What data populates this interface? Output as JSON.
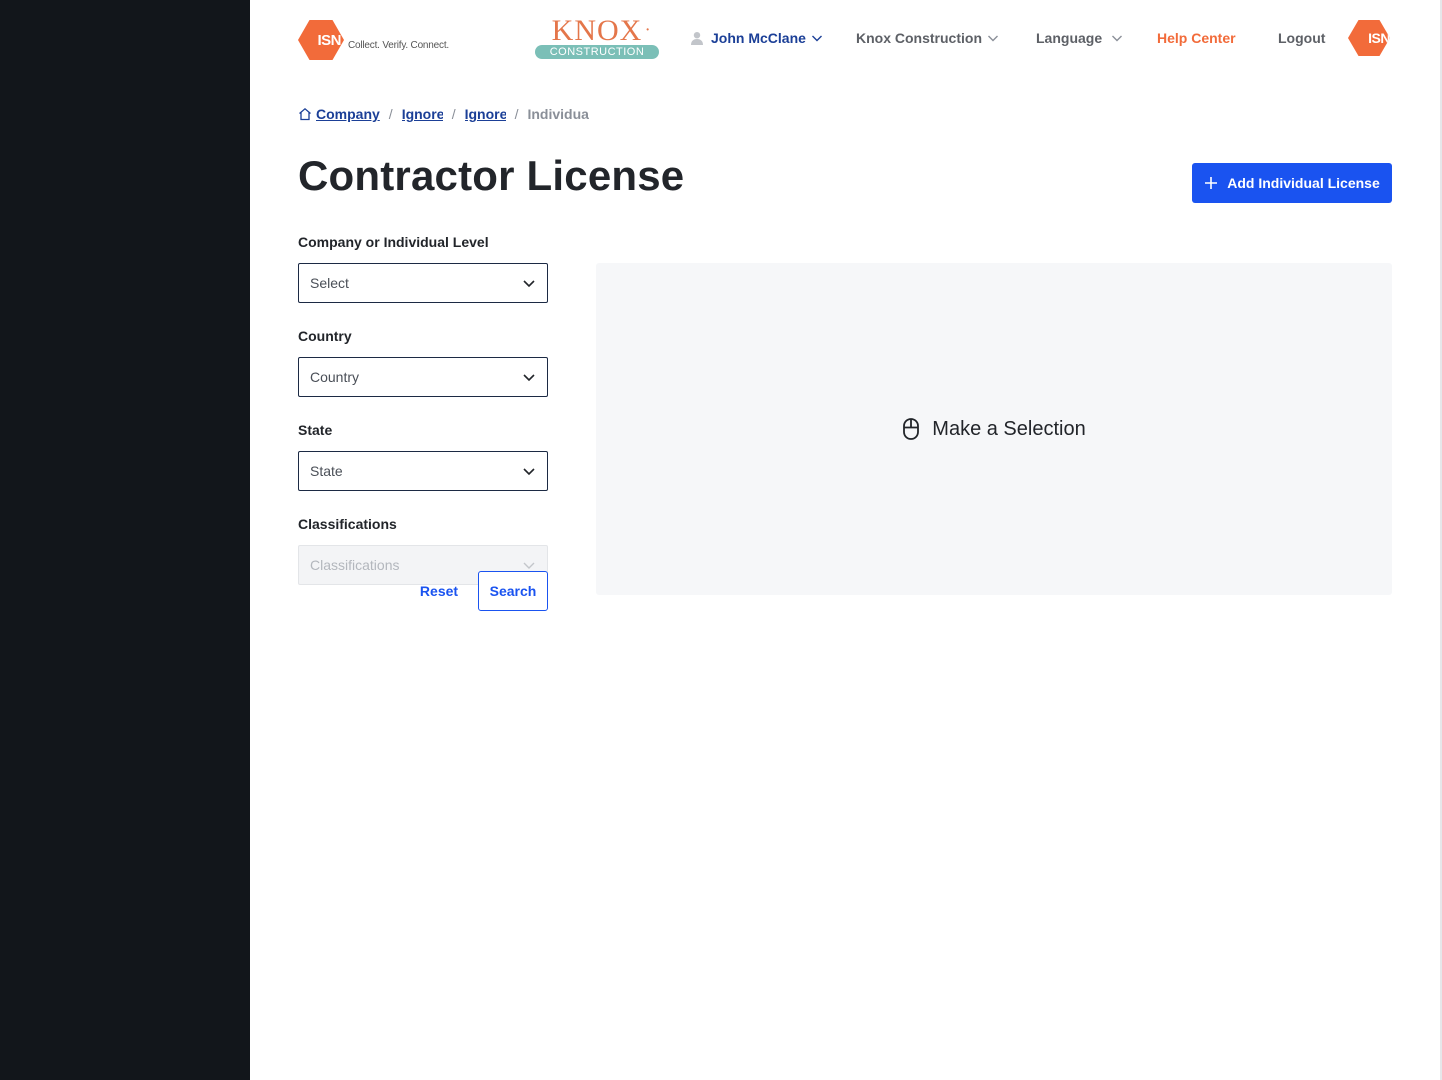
{
  "header": {
    "isn_logo_text": "ISN",
    "isn_tagline": "Collect. Verify. Connect.",
    "client_logo_word": "KNOX",
    "client_logo_band": "CONSTRUCTION",
    "user_name": "John McClane",
    "company_menu": "Knox Construction",
    "language_menu": "Language",
    "help_center": "Help Center",
    "logout": "Logout",
    "isn_logo_right_text": "ISN"
  },
  "breadcrumb": {
    "items": [
      "Company",
      "Ignore",
      "Ignore"
    ],
    "current": "Individua"
  },
  "page": {
    "title": "Contractor License",
    "add_button_label": "Add Individual License"
  },
  "filters": {
    "level": {
      "label": "Company or Individual Level",
      "value": "Select"
    },
    "country": {
      "label": "Country",
      "value": "Country"
    },
    "state": {
      "label": "State",
      "value": "State"
    },
    "classifications": {
      "label": "Classifications",
      "value": "Classifications",
      "disabled": true
    },
    "reset_label": "Reset",
    "search_label": "Search"
  },
  "empty_state": {
    "message": "Make a Selection",
    "icon": "mouse-icon"
  },
  "colors": {
    "brand_orange": "#f26b3a",
    "primary_blue": "#1a53f0",
    "nav_blue": "#1b3f97",
    "rail_dark": "#12161b"
  }
}
